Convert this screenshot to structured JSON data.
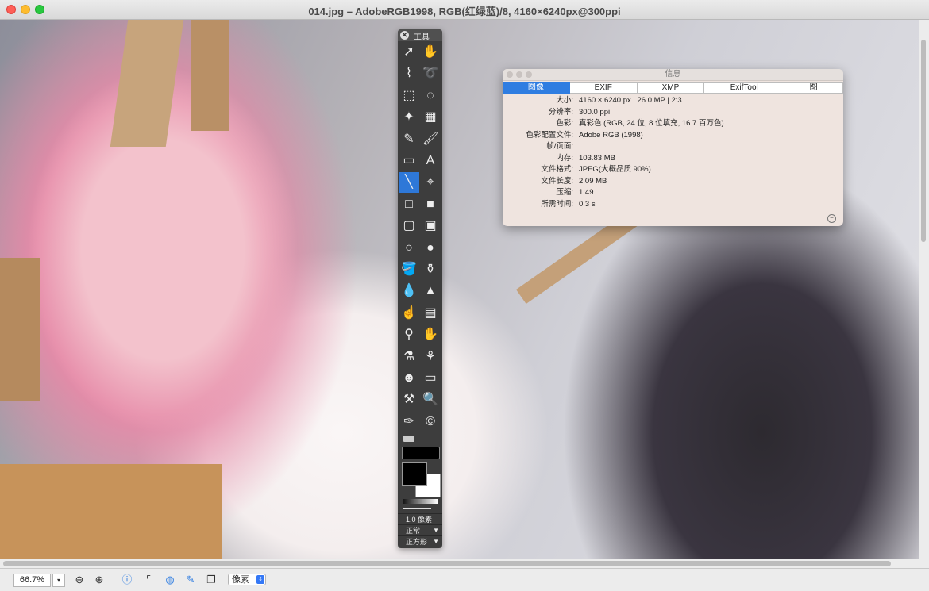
{
  "window": {
    "title": "014.jpg – AdobeRGB1998, RGB(红绿蓝)/8, 4160×6240px@300ppi"
  },
  "tool_palette": {
    "title": "工具",
    "tools": [
      {
        "name": "arrow",
        "glyph": "➚"
      },
      {
        "name": "hand",
        "glyph": "✋"
      },
      {
        "name": "polygon-lasso",
        "glyph": "⌇"
      },
      {
        "name": "lasso",
        "glyph": "➰"
      },
      {
        "name": "rect-select",
        "glyph": "⬚"
      },
      {
        "name": "ellipse-select",
        "glyph": "◌"
      },
      {
        "name": "magic-wand",
        "glyph": "✦"
      },
      {
        "name": "checker",
        "glyph": "▦"
      },
      {
        "name": "pencil",
        "glyph": "✎"
      },
      {
        "name": "brush",
        "glyph": "🖌"
      },
      {
        "name": "eraser",
        "glyph": "▭"
      },
      {
        "name": "text",
        "glyph": "A"
      },
      {
        "name": "line",
        "glyph": "╲"
      },
      {
        "name": "crosshair",
        "glyph": "⌖"
      },
      {
        "name": "rect",
        "glyph": "□"
      },
      {
        "name": "rect-filled",
        "glyph": "■"
      },
      {
        "name": "roundrect",
        "glyph": "▢"
      },
      {
        "name": "roundrect-filled",
        "glyph": "▣"
      },
      {
        "name": "ellipse",
        "glyph": "○"
      },
      {
        "name": "ellipse-filled",
        "glyph": "●"
      },
      {
        "name": "paint-bucket",
        "glyph": "🪣"
      },
      {
        "name": "stamp",
        "glyph": "⚱"
      },
      {
        "name": "drop",
        "glyph": "💧"
      },
      {
        "name": "cone",
        "glyph": "▲"
      },
      {
        "name": "smudge",
        "glyph": "☝"
      },
      {
        "name": "sponge",
        "glyph": "▤"
      },
      {
        "name": "dodge",
        "glyph": "⚲"
      },
      {
        "name": "burn",
        "glyph": "✋"
      },
      {
        "name": "eyedropper",
        "glyph": "⚗"
      },
      {
        "name": "clone",
        "glyph": "⚘"
      },
      {
        "name": "silhouette",
        "glyph": "☻"
      },
      {
        "name": "ruler",
        "glyph": "▭"
      },
      {
        "name": "transform",
        "glyph": "⚒"
      },
      {
        "name": "zoom",
        "glyph": "🔍"
      },
      {
        "name": "bottle",
        "glyph": "✑"
      },
      {
        "name": "copyright",
        "glyph": "©"
      }
    ],
    "line_width_label": "1.0 像素",
    "blend_mode": "正常",
    "brush_shape": "正方形",
    "selected_tool": "line",
    "fg_color": "#000000",
    "bg_color": "#ffffff"
  },
  "info_panel": {
    "title": "信息",
    "tabs": [
      "图像",
      "EXIF",
      "XMP",
      "ExifTool",
      "图"
    ],
    "active_tab": "图像",
    "rows": [
      {
        "k": "大小:",
        "v": "4160 × 6240 px | 26.0 MP | 2:3"
      },
      {
        "k": "分辨率:",
        "v": "300.0 ppi"
      },
      {
        "k": "色彩:",
        "v": "真彩色 (RGB, 24 位, 8 位填充, 16.7 百万色)"
      },
      {
        "k": "色彩配置文件:",
        "v": "Adobe RGB (1998)"
      },
      {
        "k": "帧/页面:",
        "v": ""
      },
      {
        "k": "内存:",
        "v": "103.83 MB"
      },
      {
        "k": "文件格式:",
        "v": "JPEG(大概品质 90%)"
      },
      {
        "k": "文件长度:",
        "v": "2.09 MB"
      },
      {
        "k": "压缩:",
        "v": "1:49"
      },
      {
        "k": "所需时间:",
        "v": "0.3 s"
      }
    ]
  },
  "bottom_bar": {
    "zoom": "66.7%",
    "units": "像素"
  },
  "colors": {
    "accent": "#2f7de1",
    "palette_bg": "#3d3d3d",
    "panel_bg": "#efe4df"
  }
}
